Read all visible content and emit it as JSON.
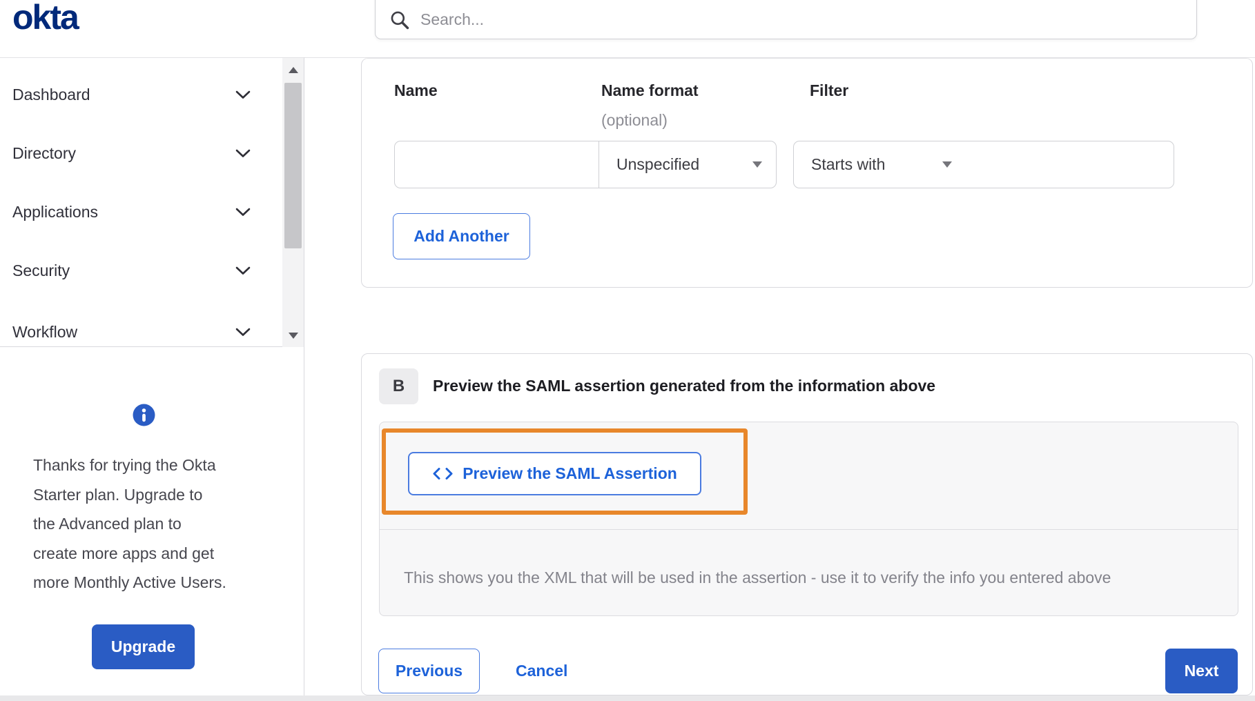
{
  "brand": {
    "logo_text": "okta"
  },
  "header": {
    "search": {
      "placeholder": "Search...",
      "value": ""
    }
  },
  "sidebar": {
    "nav": {
      "items": [
        {
          "label": "Dashboard"
        },
        {
          "label": "Directory"
        },
        {
          "label": "Applications"
        },
        {
          "label": "Security"
        },
        {
          "label": "Workflow"
        }
      ]
    },
    "promo": {
      "lines": [
        "Thanks for trying the Okta",
        "Starter plan. Upgrade to",
        "the Advanced plan to",
        "create more apps and get",
        "more Monthly Active Users."
      ],
      "upgrade_label": "Upgrade"
    }
  },
  "form": {
    "name_label": "Name",
    "name_format_label": "Name format",
    "name_format_hint": "(optional)",
    "filter_label": "Filter",
    "row": {
      "name_value": "",
      "name_format_value": "Unspecified",
      "filter_type_value": "Starts with",
      "filter_value": ""
    },
    "add_another_label": "Add Another"
  },
  "preview": {
    "badge": "B",
    "heading": "Preview the SAML assertion generated from the information above",
    "button_label": "Preview the SAML Assertion",
    "description": "This shows you the XML that will be used in the assertion - use it to verify the info you entered above"
  },
  "footer": {
    "previous_label": "Previous",
    "cancel_label": "Cancel",
    "next_label": "Next"
  },
  "icons": {
    "search-icon": "magnifying-glass",
    "chevron-down-icon": "chevron-down",
    "caret-down-icon": "filled-triangle-down",
    "info-icon": "circle-i",
    "code-icon": "angle-brackets",
    "scroll-up-icon": "triangle-up",
    "scroll-down-icon": "triangle-down"
  },
  "colors": {
    "link_blue": "#1d62d9",
    "button_blue": "#2a5cc4",
    "logo_navy": "#00297a",
    "annotation_orange": "#e8872b"
  }
}
